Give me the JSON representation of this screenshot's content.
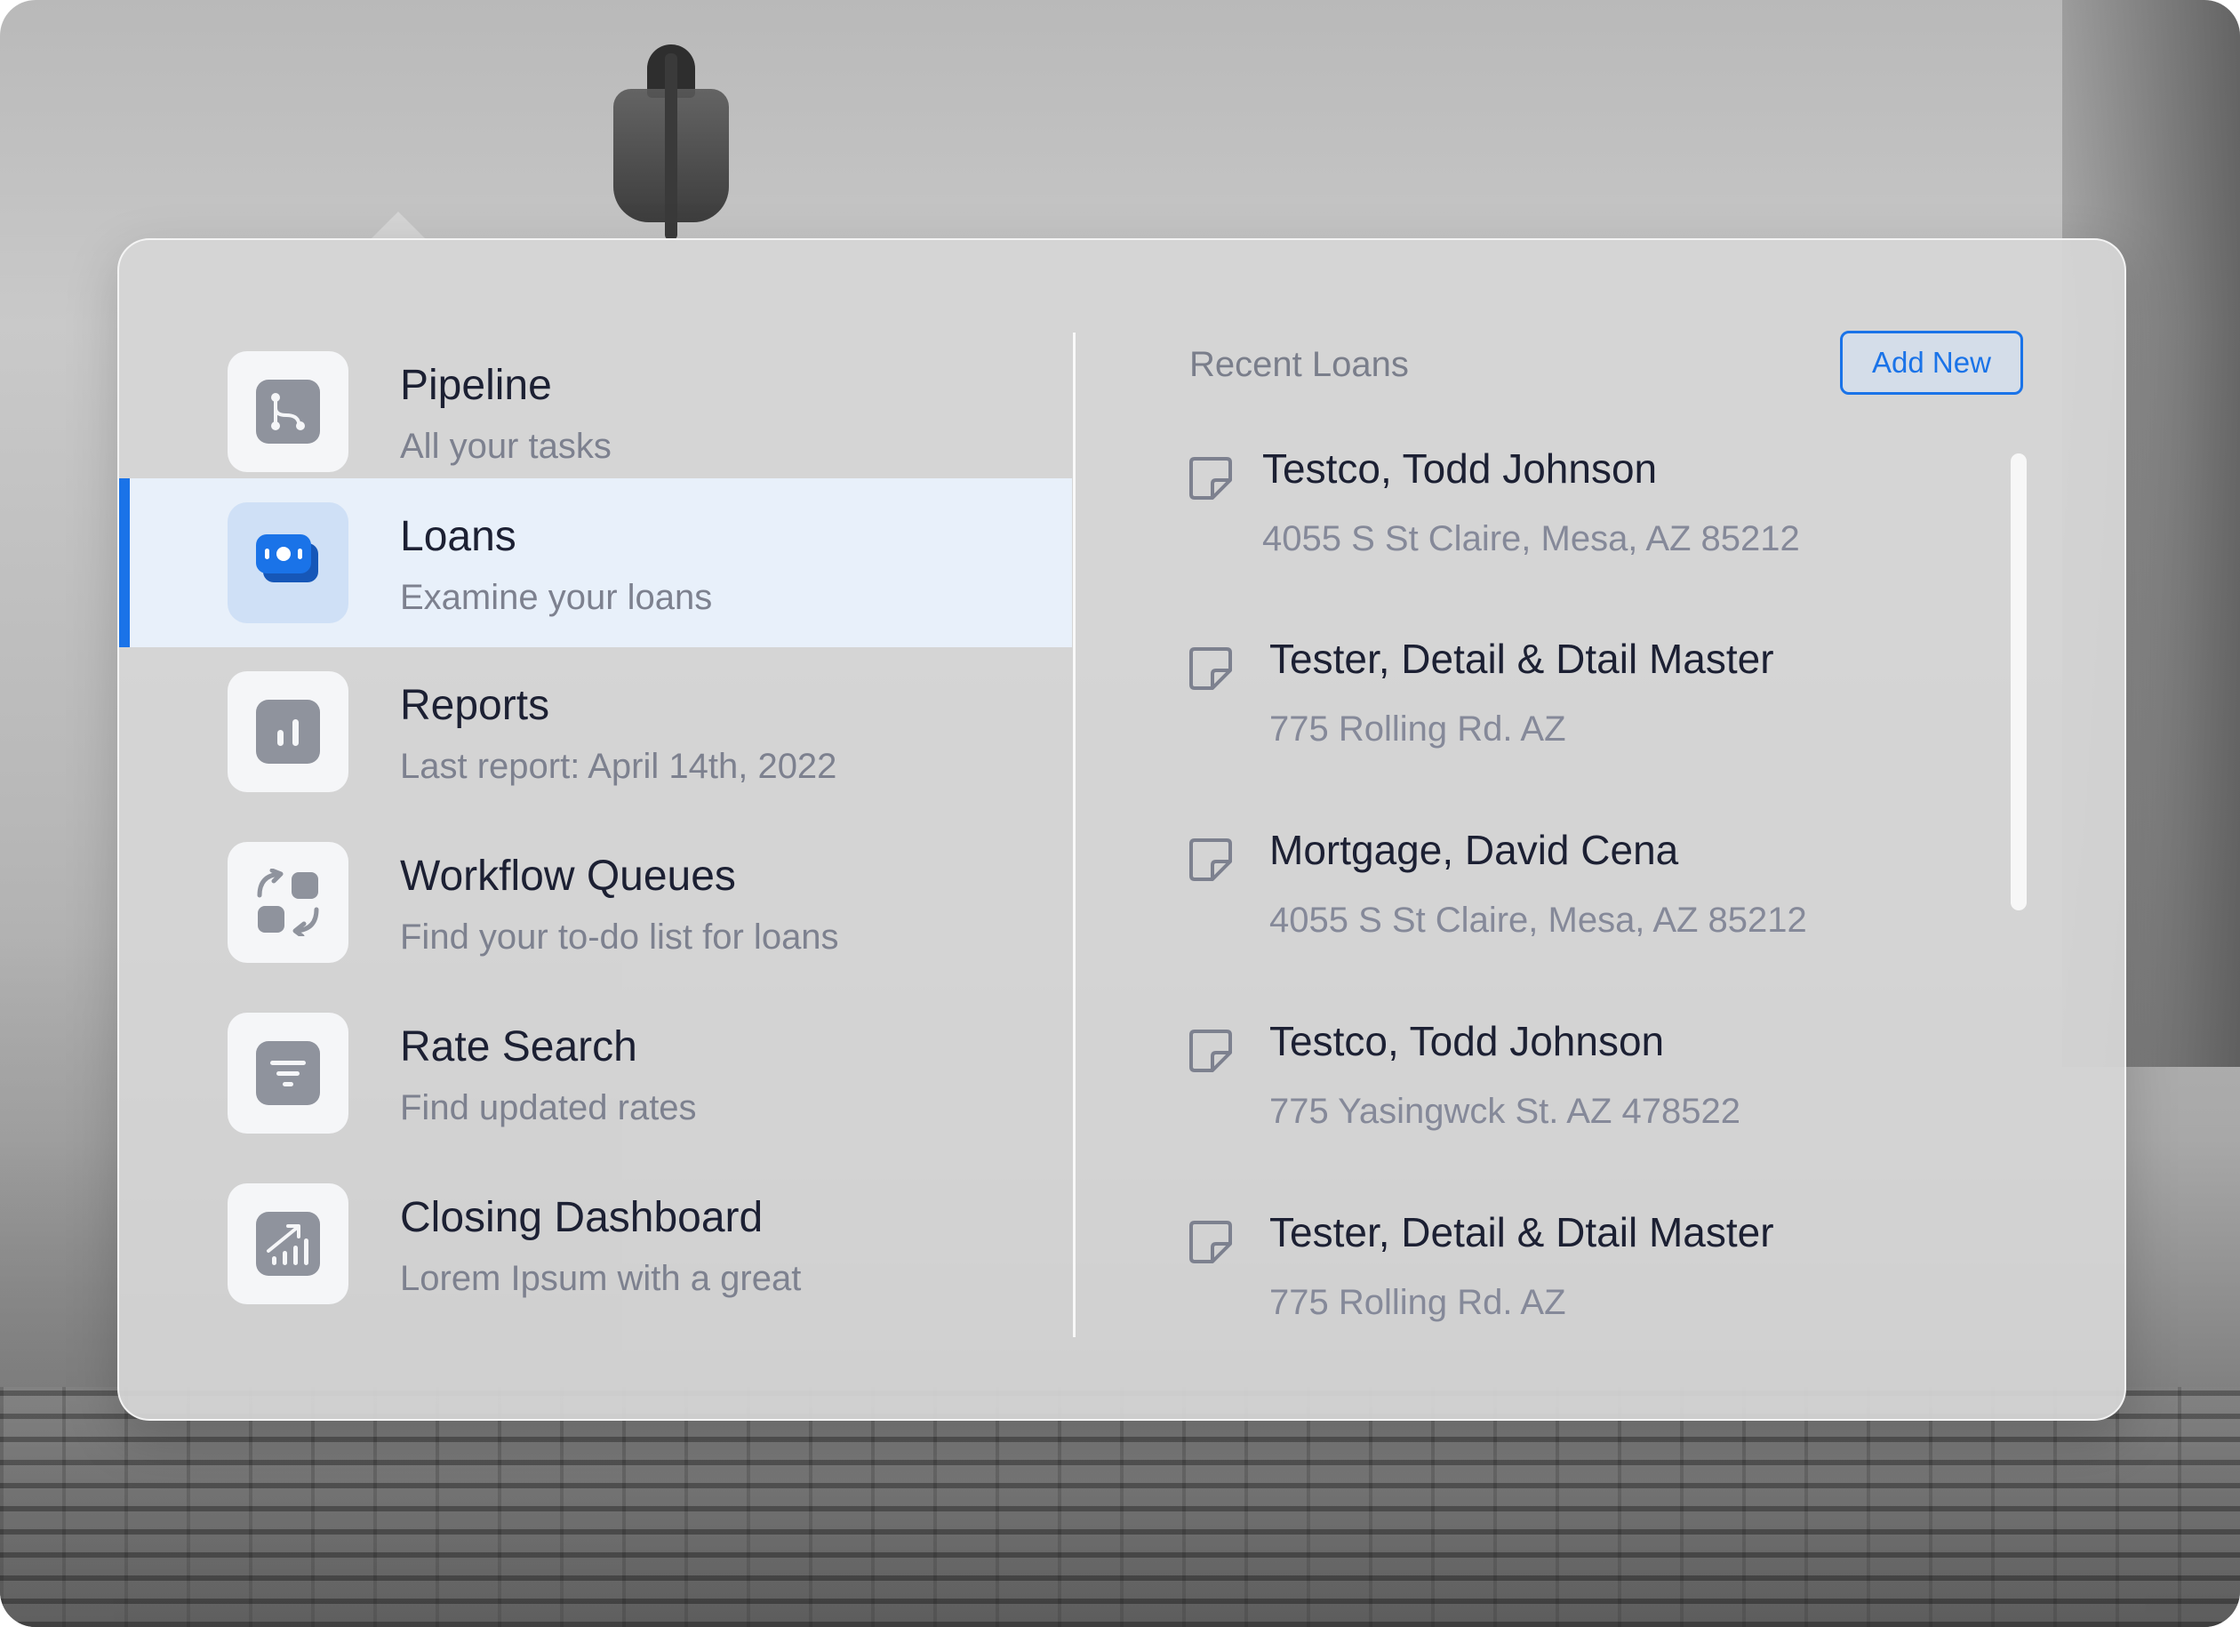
{
  "menu": {
    "items": [
      {
        "title": "Pipeline",
        "subtitle": "All your tasks",
        "icon": "branch-icon"
      },
      {
        "title": "Loans",
        "subtitle": "Examine your loans",
        "icon": "money-icon",
        "active": true
      },
      {
        "title": "Reports",
        "subtitle": "Last report: April 14th, 2022",
        "icon": "bar-chart-icon"
      },
      {
        "title": "Workflow Queues",
        "subtitle": "Find your to-do list for loans",
        "icon": "workflow-icon"
      },
      {
        "title": "Rate Search",
        "subtitle": "Find updated rates",
        "icon": "filter-icon"
      },
      {
        "title": "Closing Dashboard",
        "subtitle": "Lorem Ipsum with a great",
        "icon": "trend-chart-icon"
      }
    ]
  },
  "recent": {
    "title": "Recent Loans",
    "add_button": "Add New",
    "loans": [
      {
        "name": "Testco, Todd Johnson",
        "address": "4055 S St Claire, Mesa, AZ 85212"
      },
      {
        "name": "Tester, Detail & Dtail Master",
        "address": "775 Rolling Rd. AZ"
      },
      {
        "name": "Mortgage, David Cena",
        "address": "4055 S St Claire, Mesa, AZ 85212"
      },
      {
        "name": "Testco, Todd Johnson",
        "address": "775 Yasingwck St. AZ 478522"
      },
      {
        "name": "Tester, Detail & Dtail Master",
        "address": "775 Rolling Rd. AZ"
      }
    ]
  },
  "colors": {
    "accent": "#1a73e8",
    "title_text": "#1c2033",
    "muted_text": "#7d818f"
  }
}
